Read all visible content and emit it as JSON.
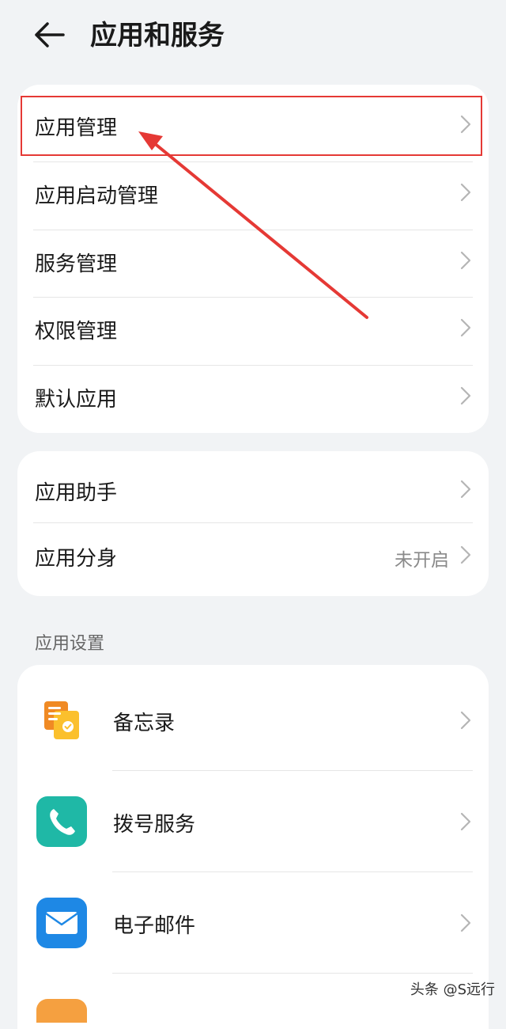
{
  "header": {
    "title": "应用和服务",
    "back_icon": "arrow-left-icon"
  },
  "group1": [
    {
      "label": "应用管理"
    },
    {
      "label": "应用启动管理"
    },
    {
      "label": "服务管理"
    },
    {
      "label": "权限管理"
    },
    {
      "label": "默认应用"
    }
  ],
  "group2": [
    {
      "label": "应用助手",
      "value": ""
    },
    {
      "label": "应用分身",
      "value": "未开启"
    }
  ],
  "section_label": "应用设置",
  "apps": [
    {
      "label": "备忘录",
      "icon": "notes-icon"
    },
    {
      "label": "拨号服务",
      "icon": "phone-icon"
    },
    {
      "label": "电子邮件",
      "icon": "mail-icon"
    }
  ],
  "watermark": "头条 @S远行",
  "colors": {
    "background": "#f1f3f5",
    "card": "#ffffff",
    "annotation": "#e53935",
    "value_text": "#8a8a8a"
  }
}
